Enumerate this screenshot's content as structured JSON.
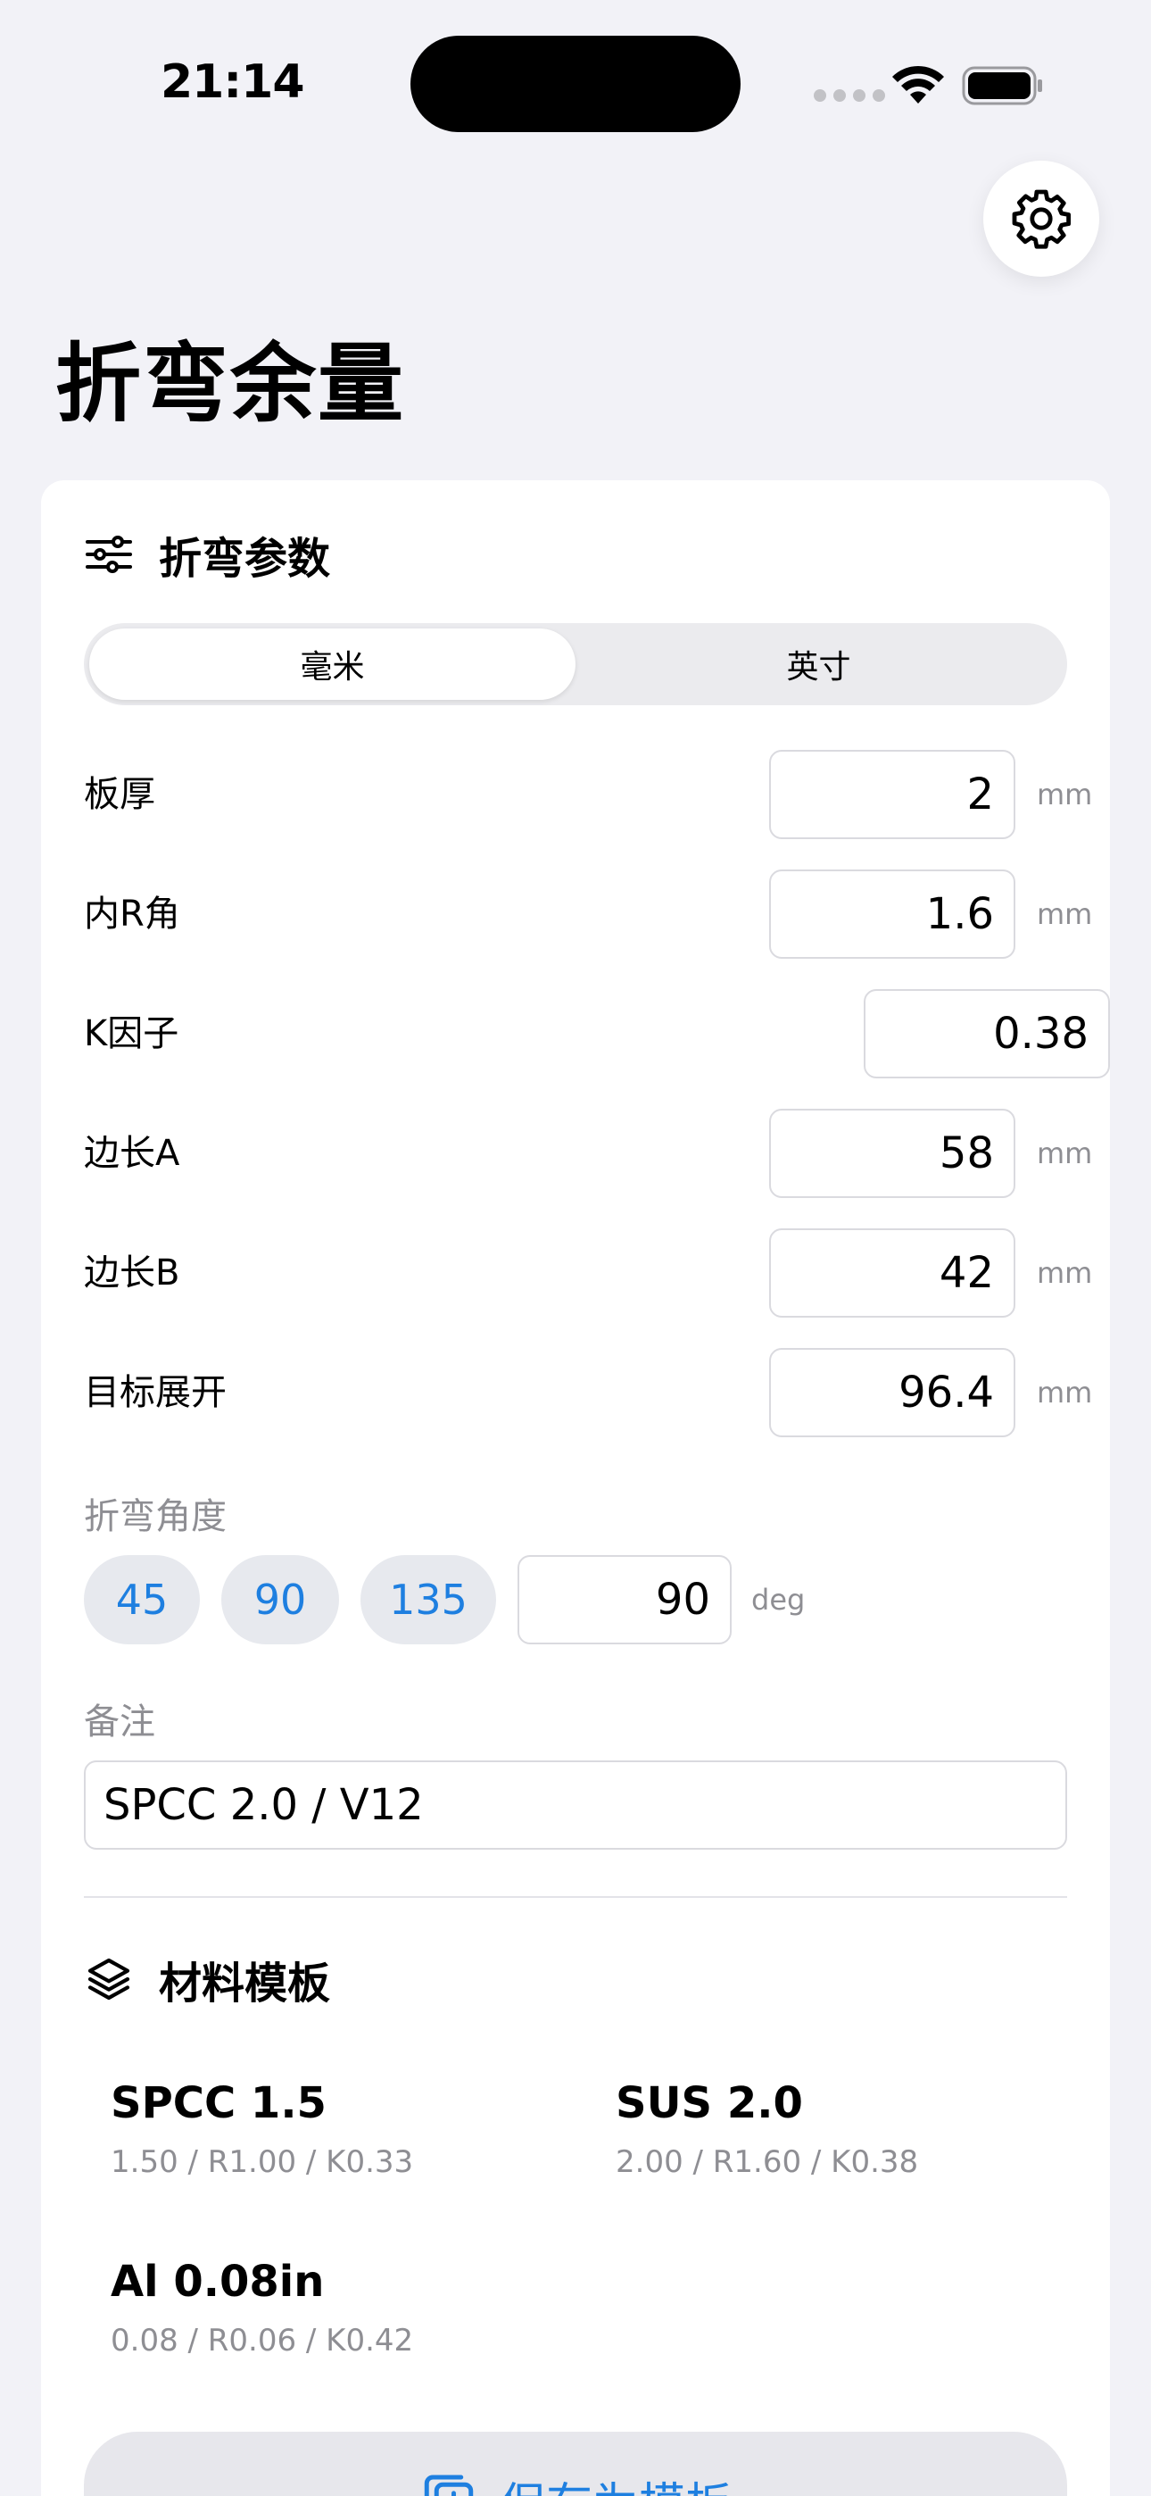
{
  "status_bar": {
    "time": "21:14"
  },
  "header": {
    "title": "折弯余量"
  },
  "params": {
    "title": "折弯参数",
    "units": [
      "毫米",
      "英寸"
    ],
    "selected_unit": "毫米",
    "fields": [
      {
        "label": "板厚",
        "value": "2",
        "unit": "mm"
      },
      {
        "label": "内R角",
        "value": "1.6",
        "unit": "mm"
      },
      {
        "label": "K因子",
        "value": "0.38",
        "unit": ""
      },
      {
        "label": "边长A",
        "value": "58",
        "unit": "mm"
      },
      {
        "label": "边长B",
        "value": "42",
        "unit": "mm"
      },
      {
        "label": "目标展开",
        "value": "96.4",
        "unit": "mm"
      }
    ],
    "angle": {
      "label": "折弯角度",
      "presets": [
        "45",
        "90",
        "135"
      ],
      "value": "90",
      "unit": "deg"
    },
    "note": {
      "label": "备注",
      "value": "SPCC 2.0 / V12"
    }
  },
  "templates": {
    "title": "材料模板",
    "items": [
      {
        "name": "SPCC 1.5",
        "meta": "1.50 / R1.00 / K0.33"
      },
      {
        "name": "SUS 2.0",
        "meta": "2.00 / R1.60 / K0.38"
      },
      {
        "name": "Al 0.08in",
        "meta": "0.08 / R0.06 / K0.42"
      }
    ],
    "save_label": "保存为模板"
  },
  "colors": {
    "accent": "#1E7FE0",
    "background": "#F2F2F7",
    "card": "#FFFFFF",
    "secondary_text": "#8E8E93"
  }
}
